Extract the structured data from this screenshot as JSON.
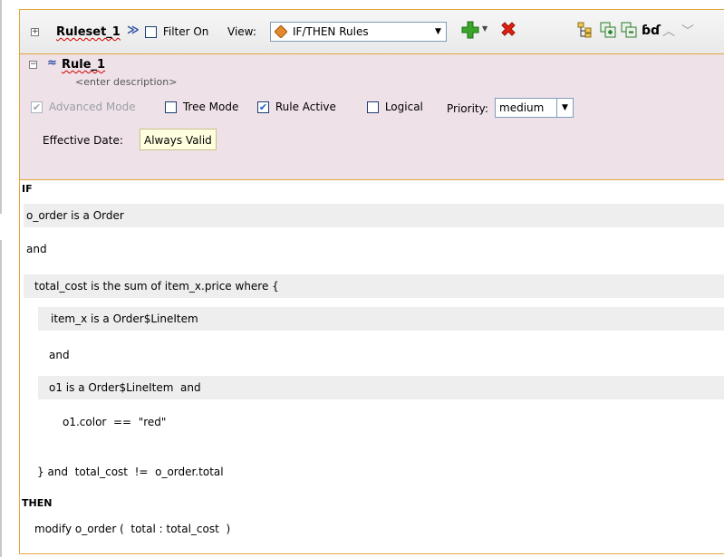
{
  "toolbar": {
    "ruleset_name": "Ruleset_1",
    "filter_label": "Filter On",
    "view_label": "View:",
    "view_value": "IF/THEN Rules"
  },
  "rule": {
    "name": "Rule_1",
    "description": "<enter description>",
    "advanced_mode_label": "Advanced Mode",
    "tree_mode_label": "Tree Mode",
    "rule_active_label": "Rule Active",
    "logical_label": "Logical",
    "priority_label": "Priority:",
    "priority_value": "medium",
    "effective_date_label": "Effective Date:",
    "effective_date_value": "Always Valid"
  },
  "body": {
    "if_label": "IF",
    "then_label": "THEN",
    "lines": [
      "o_order is a Order",
      "and",
      "total_cost is the sum of item_x.price where {",
      "item_x is a Order$LineItem",
      "and",
      "o1 is a Order$LineItem  and",
      "o1.color  ==  \"red\"",
      "} and  total_cost  !=  o_order.total"
    ],
    "action": "modify o_order (  total : total_cost  )"
  },
  "colors": {
    "accent_border": "#e3a63a",
    "rule_header_bg": "#efe1e8",
    "row_shade": "#eeeeee"
  }
}
